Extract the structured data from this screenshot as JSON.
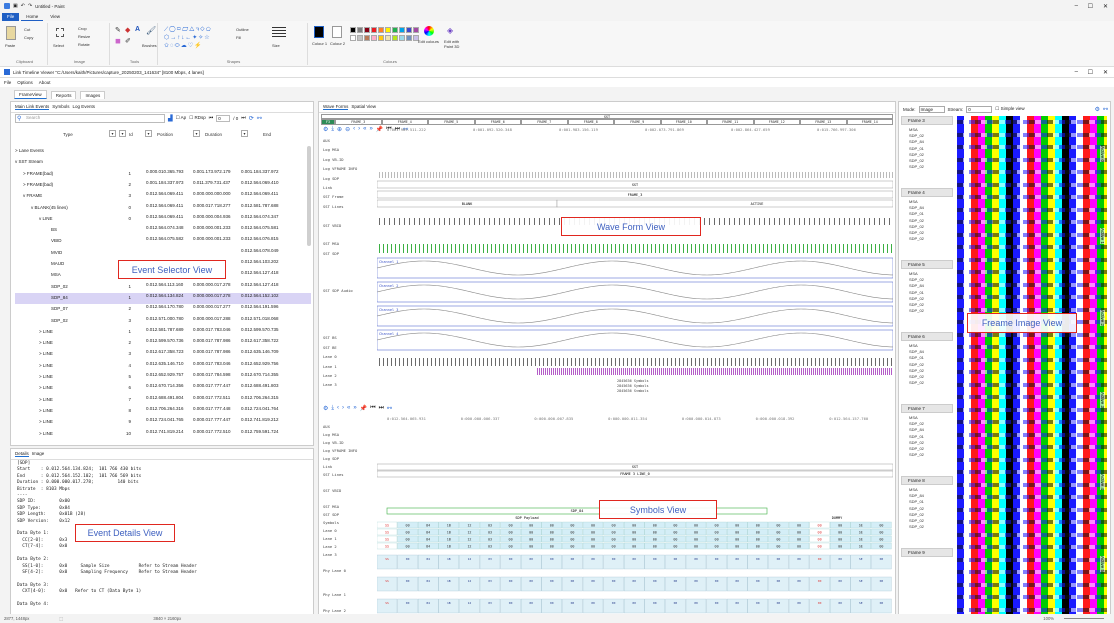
{
  "paint": {
    "title": "Untitled - Paint",
    "tabs": [
      "File",
      "Home",
      "View"
    ],
    "groups": {
      "clipboard": {
        "caption": "Clipboard",
        "paste": "Paste",
        "cut": "Cut",
        "copy": "Copy"
      },
      "image": {
        "caption": "Image",
        "select": "Select",
        "crop": "Crop",
        "resize": "Resize",
        "rotate": "Rotate"
      },
      "tools": {
        "caption": "Tools",
        "brushes": "Brushes"
      },
      "shapes": {
        "caption": "Shapes",
        "outline": "Outline",
        "fill": "Fill",
        "size": "Size"
      },
      "colours": {
        "caption": "Colours",
        "colour1": "Colour 1",
        "colour2": "Colour 2",
        "edit": "Edit colours",
        "edit3d": "Edit with Paint 3D"
      }
    },
    "palette": [
      "#000000",
      "#7f7f7f",
      "#880015",
      "#ed1c24",
      "#ff7f27",
      "#fff200",
      "#22b14c",
      "#00a2e8",
      "#3f48cc",
      "#a349a4",
      "#ffffff",
      "#c3c3c3",
      "#b97a57",
      "#ffaec9",
      "#ffc90e",
      "#efe4b0",
      "#b5e61d",
      "#99d9ea",
      "#7092be",
      "#c8bfe7"
    ]
  },
  "timeline": {
    "title": "Link Timeline Viewer \"C:/Users/kaith/Pictures/capture_20250203_141634\" [8100 Mbps, 4 lanes]",
    "menu": [
      "File",
      "Options",
      "About"
    ],
    "view_tabs": [
      "FrameView",
      "Reports",
      "Images"
    ]
  },
  "left": {
    "tabs": [
      "Main Link Events",
      "Symbols",
      "Log Events"
    ],
    "search_placeholder": "Search",
    "checkboxes": [
      "Ap",
      "RDsp"
    ],
    "page_box": "0",
    "page_of": "/ 0",
    "columns": [
      "Type",
      "Id",
      "Position",
      "Duration",
      "End"
    ],
    "rows": [
      {
        "name": "> Lane Events",
        "indent": 0
      },
      {
        "name": "v SST Stream",
        "indent": 0
      },
      {
        "name": "> FRAME(bad)",
        "indent": 8,
        "id": "1",
        "pos": "0.000.010.365.793",
        "dur": "0.001.173.972.179",
        "end": "0.001.184.337.972"
      },
      {
        "name": "> FRAME(bad)",
        "indent": 8,
        "id": "2",
        "pos": "0.001.184.337.973",
        "dur": "0.011.379.731.437",
        "end": "0.012.564.069.410"
      },
      {
        "name": "v FRAME",
        "indent": 8,
        "id": "3",
        "pos": "0.012.564.069.411",
        "dur": "0.000.000.000.000",
        "end": "0.012.564.069.411"
      },
      {
        "name": "v BLANK(45 lines)",
        "indent": 16,
        "id": "0",
        "pos": "0.012.564.069.411",
        "dur": "0.000.017.718.277",
        "end": "0.012.581.787.688"
      },
      {
        "name": "v LINE",
        "indent": 24,
        "id": "0",
        "pos": "0.012.564.069.411",
        "dur": "0.000.000.004.936",
        "end": "0.012.564.074.347"
      },
      {
        "name": "BS",
        "indent": 36,
        "id": "",
        "pos": "0.012.564.074.348",
        "dur": "0.000.000.001.233",
        "end": "0.012.564.075.581"
      },
      {
        "name": "VBID",
        "indent": 36,
        "id": "",
        "pos": "0.012.564.075.582",
        "dur": "0.000.000.001.233",
        "end": "0.012.564.076.815"
      },
      {
        "name": "MVID",
        "indent": 36,
        "id": "",
        "pos": "",
        "dur": "",
        "end": "0.012.564.078.049"
      },
      {
        "name": "MAUD",
        "indent": 36,
        "id": "",
        "pos": "",
        "dur": "",
        "end": "0.012.564.103.202"
      },
      {
        "name": "MSA",
        "indent": 36,
        "id": "",
        "pos": "",
        "dur": "",
        "end": "0.012.564.127.418"
      },
      {
        "name": "SDP_02",
        "indent": 36,
        "id": "1",
        "pos": "0.012.564.113.160",
        "dur": "0.000.000.017.278",
        "end": "0.012.564.127.418"
      },
      {
        "name": "SDP_84",
        "indent": 36,
        "id": "1",
        "pos": "0.012.564.134.824",
        "dur": "0.000.000.017.278",
        "end": "0.012.564.152.102",
        "selected": true
      },
      {
        "name": "SDP_07",
        "indent": 36,
        "id": "2",
        "pos": "0.012.564.170.780",
        "dur": "0.000.000.017.277",
        "end": "0.012.564.191.596"
      },
      {
        "name": "SDP_02",
        "indent": 36,
        "id": "3",
        "pos": "0.012.571.000.780",
        "dur": "0.000.000.017.288",
        "end": "0.012.571.018.068"
      },
      {
        "name": "> LINE",
        "indent": 24,
        "id": "1",
        "pos": "0.012.581.787.689",
        "dur": "0.000.017.783.046",
        "end": "0.012.599.570.735"
      },
      {
        "name": "> LINE",
        "indent": 24,
        "id": "2",
        "pos": "0.012.599.570.736",
        "dur": "0.000.017.787.986",
        "end": "0.012.617.358.722"
      },
      {
        "name": "> LINE",
        "indent": 24,
        "id": "3",
        "pos": "0.012.617.358.723",
        "dur": "0.000.017.787.986",
        "end": "0.012.635.146.709"
      },
      {
        "name": "> LINE",
        "indent": 24,
        "id": "4",
        "pos": "0.012.635.146.710",
        "dur": "0.000.017.783.046",
        "end": "0.012.652.929.756"
      },
      {
        "name": "> LINE",
        "indent": 24,
        "id": "5",
        "pos": "0.012.652.929.757",
        "dur": "0.000.017.784.598",
        "end": "0.012.670.714.355"
      },
      {
        "name": "> LINE",
        "indent": 24,
        "id": "6",
        "pos": "0.012.670.714.356",
        "dur": "0.000.017.777.447",
        "end": "0.012.688.491.803"
      },
      {
        "name": "> LINE",
        "indent": 24,
        "id": "7",
        "pos": "0.012.688.491.804",
        "dur": "0.000.017.772.511",
        "end": "0.012.706.264.315"
      },
      {
        "name": "> LINE",
        "indent": 24,
        "id": "8",
        "pos": "0.012.706.264.316",
        "dur": "0.000.017.777.448",
        "end": "0.012.724.041.764"
      },
      {
        "name": "> LINE",
        "indent": 24,
        "id": "9",
        "pos": "0.012.724.041.765",
        "dur": "0.000.017.777.447",
        "end": "0.012.741.819.212"
      },
      {
        "name": "> LINE",
        "indent": 24,
        "id": "10",
        "pos": "0.012.741.819.214",
        "dur": "0.000.017.772.510",
        "end": "0.012.759.591.724"
      }
    ]
  },
  "details": {
    "tabs": [
      "Details",
      "Image"
    ],
    "text": "[SDP]\nStart    : 0.012.564.134.824;  101 766 430 bits\nEnd      : 0.012.564.152.102;  101 766 569 bits\nDuration : 0.000.000.017.278;         140 bits\nBitrate  : 8103 Mbps\n----\nSDP ID:         0x00\nSDP Type:       0x84\nSDP Length:     0x01B (28)\nSDP Version:    0x12\n\nData Byte 1:\n  CC[2-0]:      0x3\n  CT[7-4]:      0x0\n\nData Byte 2:\n  SS[1-0]:      0x0     Sample Size           Refer to Stream Header\n  SF[4-2]:      0x0     Sampling Frequency    Refer to Stream Header\n\nData Byte 3:\n  CXT[4-0]:     0x0   Refer to CT (Data Byte 1)\n\nData Byte 4:"
  },
  "middle": {
    "tabs": [
      "Wave Forms",
      "Spatial View"
    ],
    "top_ruler": [
      "0:001.909.511.222",
      "0:001.092.520.348",
      "0:001.983.156.119",
      "0:002.073.791.869",
      "0:002.864.427.659",
      "0:015.766.997.306"
    ],
    "frame_labels": [
      "F3",
      "FRAME_3",
      "FRAME_4",
      "FRAME_5",
      "FRAME_6",
      "FRAME_7",
      "FRAME_8",
      "FRAME_9",
      "FRAME_10",
      "FRAME_11",
      "FRAME_12",
      "FRAME_13",
      "FRAME_14"
    ],
    "sst_label": "SST",
    "top_signals": [
      "AUX",
      "Log MSA",
      "Log VB-ID",
      "Log VFRAME INFO",
      "Log SDP",
      "Link",
      "SST Frame",
      "SST Lines",
      "",
      "SST VBID",
      "",
      "SST MSA",
      "SST SDP",
      "",
      "",
      "",
      "SST SDP Audio",
      "",
      "",
      "",
      "",
      "SST BS",
      "SST BE",
      "Lane 0",
      "Lane 1",
      "Lane 2",
      "Lane 3"
    ],
    "sst_bar": "SST",
    "frame3": "FRAME_3",
    "blank": "BLANK",
    "active": "ACTIVE",
    "channels": [
      "Channel 1",
      "Channel 2",
      "Channel 3",
      "Channel 4"
    ],
    "symbols_count": "2845636 Symbols",
    "bottom_ruler": [
      "0:012.564.065.931",
      "0:000.000.006.337",
      "0:000.000.007.835",
      "0:000.000.011.354",
      "0:000.000.014.873",
      "0:000.000.018.392",
      "0:012.564.157.760"
    ],
    "bottom_signals": [
      "AUX",
      "Log MSA",
      "Log VB-ID",
      "Log VFRAME INFO",
      "Log SDP",
      "Link",
      "SST Lines",
      "",
      "SST VBID",
      "",
      "SST MSA",
      "SST SDP",
      "Symbols",
      "Lane 0",
      "Lane 1",
      "Lane 2",
      "Lane 3",
      "",
      "Phy Lane 0",
      "",
      "",
      "Phy Lane 1",
      "",
      "Phy Lane 2"
    ],
    "frame_line": "FRAME 3 LINE_0",
    "sdp84": "SDP_84",
    "sdp_payload": "SDP Payload",
    "dummy": "DUMMY",
    "sym_values": [
      "SS",
      "00",
      "84",
      "1B",
      "12",
      "03",
      "00",
      "00",
      "00",
      "00",
      "00",
      "00",
      "00",
      "00",
      "00",
      "00",
      "00",
      "00",
      "00",
      "00",
      "00",
      "00",
      "00",
      "SE",
      "00"
    ]
  },
  "right": {
    "mode_label": "Mode:",
    "mode_value": "Image",
    "stream_label": "Stream:",
    "stream_value": "0",
    "simple_view": "Simple view",
    "frames": [
      {
        "title": "Frame 3",
        "items": [
          "MSA",
          "SDP_02",
          "SDP_84",
          "SDP_01",
          "SDP_02",
          "SDP_02",
          "SDP_02"
        ]
      },
      {
        "title": "Frame 4",
        "items": [
          "MSA",
          "SDP_84",
          "SDP_01",
          "SDP_02",
          "SDP_02",
          "SDP_02",
          "SDP_02"
        ]
      },
      {
        "title": "Frame 5",
        "items": [
          "MSA",
          "SDP_02",
          "SDP_84",
          "SDP_01",
          "SDP_02",
          "SDP_02",
          "SDP_02"
        ]
      },
      {
        "title": "Frame 6",
        "items": [
          "MSA",
          "SDP_84",
          "SDP_01",
          "SDP_02",
          "SDP_02",
          "SDP_02",
          "SDP_02"
        ]
      },
      {
        "title": "Frame 7",
        "items": [
          "MSA",
          "SDP_02",
          "SDP_84",
          "SDP_01",
          "SDP_02",
          "SDP_02",
          "SDP_02"
        ]
      },
      {
        "title": "Frame 8",
        "items": [
          "MSA",
          "SDP_84",
          "SDP_01",
          "SDP_02",
          "SDP_02",
          "SDP_02",
          "SDP_02"
        ]
      },
      {
        "title": "Frame 9",
        "items": []
      }
    ],
    "active_labels": [
      "Active 0",
      "Active 1",
      "Active 2",
      "Active 3",
      "Active 4",
      "Active 5"
    ],
    "bar_colors": [
      "#1a1aff",
      "#ffffff",
      "#ff1a1a",
      "#ff00ff",
      "#00cc00",
      "#ffff00",
      "#00ffff",
      "#000000"
    ]
  },
  "annotations": {
    "event_selector": "Event Selector View",
    "event_details": "Event Details View",
    "wave_form": "Wave Form View",
    "symbols": "Symbols View",
    "frame_image": "Freame Image View"
  },
  "status": {
    "coords": "2877, 1448px",
    "size": "3840 × 2160px",
    "zoom": "100%"
  }
}
